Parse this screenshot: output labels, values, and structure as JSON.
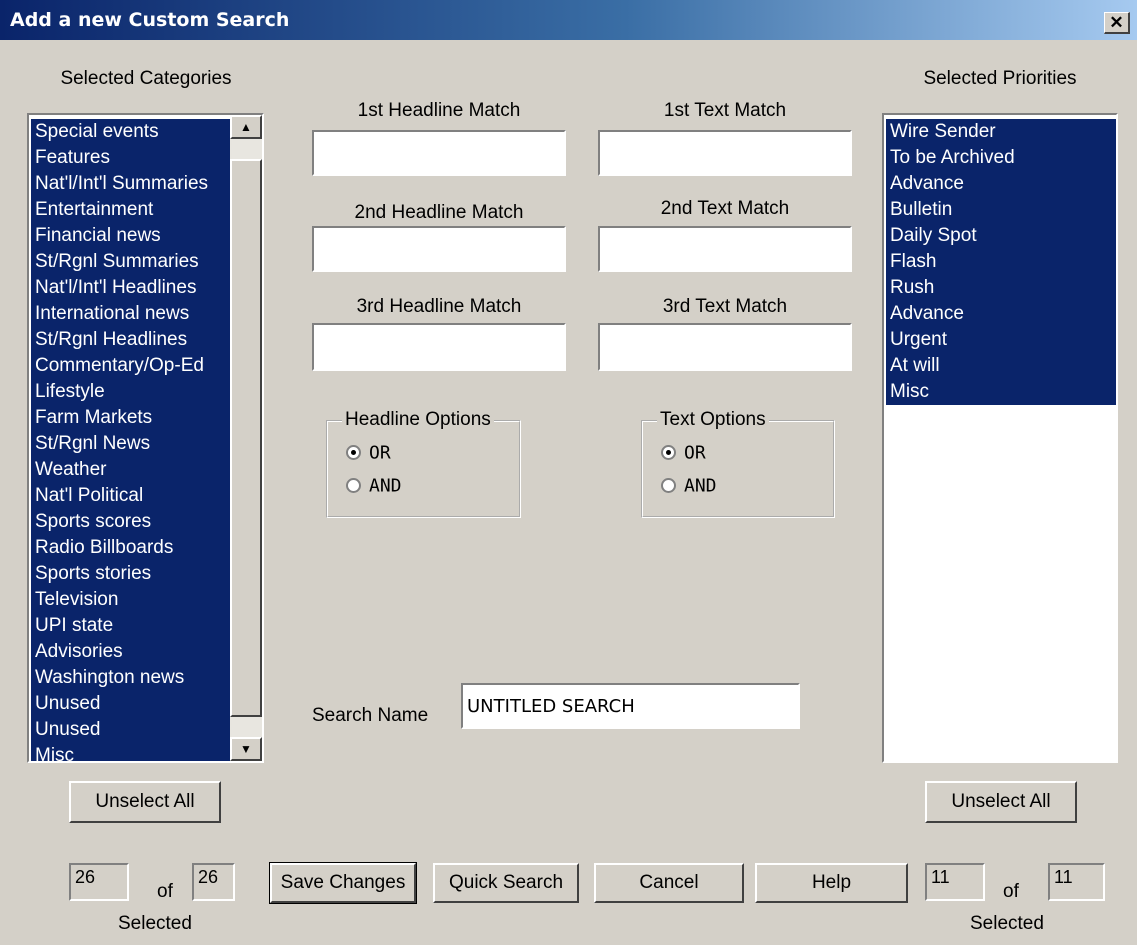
{
  "window": {
    "title": "Add a new Custom Search",
    "close_icon": "✕"
  },
  "categories": {
    "heading": "Selected Categories",
    "items": [
      "Special events",
      "Features",
      "Nat'l/Int'l Summaries",
      "Entertainment",
      "Financial news",
      "St/Rgnl Summaries",
      "Nat'l/Int'l Headlines",
      "International news",
      "St/Rgnl Headlines",
      "Commentary/Op-Ed",
      "Lifestyle",
      "Farm Markets",
      "St/Rgnl News",
      "Weather",
      "Nat'l Political",
      "Sports scores",
      "Radio Billboards",
      "Sports stories",
      "Television",
      "UPI state",
      "Advisories",
      "Washington news",
      "Unused",
      "Unused",
      "Misc"
    ],
    "scroll_up_icon": "▲",
    "scroll_down_icon": "▼",
    "unselect_label": "Unselect All",
    "selected_count": "26",
    "total_count": "26",
    "of_label": "of",
    "selected_label": "Selected"
  },
  "priorities": {
    "heading": "Selected Priorities",
    "items": [
      "Wire Sender",
      "To be Archived",
      "Advance",
      "Bulletin",
      "Daily Spot",
      "Flash",
      "Rush",
      "Advance",
      "Urgent",
      "At will",
      "Misc"
    ],
    "unselect_label": "Unselect All",
    "selected_count": "11",
    "total_count": "11",
    "of_label": "of",
    "selected_label": "Selected"
  },
  "matches": {
    "headline1_label": "1st Headline Match",
    "headline1_value": "",
    "text1_label": "1st Text Match",
    "text1_value": "",
    "headline2_label": "2nd Headline Match",
    "headline2_value": "",
    "text2_label": "2nd Text Match",
    "text2_value": "",
    "headline3_label": "3rd Headline Match",
    "headline3_value": "",
    "text3_label": "3rd Text Match",
    "text3_value": ""
  },
  "headline_options": {
    "legend": "Headline Options",
    "or_label": "OR",
    "and_label": "AND",
    "selected": "OR"
  },
  "text_options": {
    "legend": "Text Options",
    "or_label": "OR",
    "and_label": "AND",
    "selected": "OR"
  },
  "search_name": {
    "label": "Search Name",
    "value": "UNTITLED SEARCH"
  },
  "buttons": {
    "save": "Save Changes",
    "quick_search": "Quick Search",
    "cancel": "Cancel",
    "help": "Help"
  }
}
